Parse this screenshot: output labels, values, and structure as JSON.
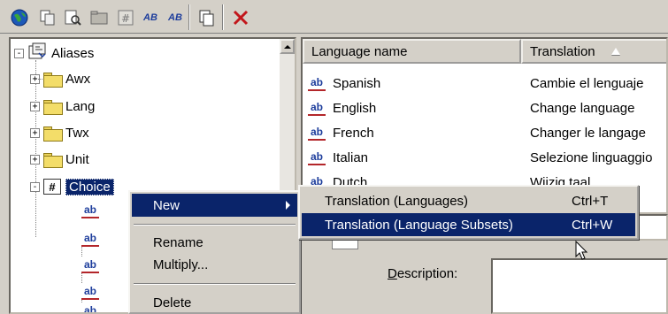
{
  "toolbar": {
    "buttons": [
      {
        "name": "globe-icon"
      },
      {
        "name": "copy-object-icon"
      },
      {
        "name": "find-icon"
      },
      {
        "name": "folder-icon"
      },
      {
        "name": "grid-icon"
      },
      {
        "name": "translation-language-icon",
        "label": "AB"
      },
      {
        "name": "translation-subset-icon",
        "label": "AB"
      },
      {
        "name": "duplicate-icon"
      },
      {
        "name": "delete-icon"
      }
    ],
    "colors": {
      "delete": "#c2161b",
      "globe": "#1c58b8"
    }
  },
  "tree": {
    "root_label": "Aliases",
    "items": [
      {
        "label": "Awx",
        "expander": "+"
      },
      {
        "label": "Lang",
        "expander": "+"
      },
      {
        "label": "Twx",
        "expander": "+"
      },
      {
        "label": "Unit",
        "expander": "+"
      }
    ],
    "choice": {
      "label": "Choice",
      "expander": "-",
      "icon_glyph": "#"
    },
    "child_icon_label": "ab",
    "root_expander": "-"
  },
  "list": {
    "columns": [
      {
        "label": "Language name"
      },
      {
        "label": "Translation"
      }
    ],
    "rows": [
      {
        "icon": "ab",
        "name": "Spanish",
        "translation": "Cambie el lenguaje"
      },
      {
        "icon": "ab",
        "name": "English",
        "translation": "Change language"
      },
      {
        "icon": "ab",
        "name": "French",
        "translation": "Changer le langage"
      },
      {
        "icon": "ab",
        "name": "Italian",
        "translation": "Selezione linguaggio"
      },
      {
        "icon": "ab",
        "name": "Dutch",
        "translation": "Wijzig taal"
      }
    ]
  },
  "detail": {
    "description_label": "Description:",
    "description_access_key": "D"
  },
  "context_menu": {
    "items": [
      {
        "label": "New",
        "has_submenu": true
      },
      {
        "label": "Rename"
      },
      {
        "label": "Multiply..."
      },
      {
        "label": "Delete"
      }
    ]
  },
  "submenu": {
    "items": [
      {
        "label": "Translation (Languages)",
        "shortcut": "Ctrl+T"
      },
      {
        "label": "Translation (Language Subsets)",
        "shortcut": "Ctrl+W"
      }
    ]
  }
}
